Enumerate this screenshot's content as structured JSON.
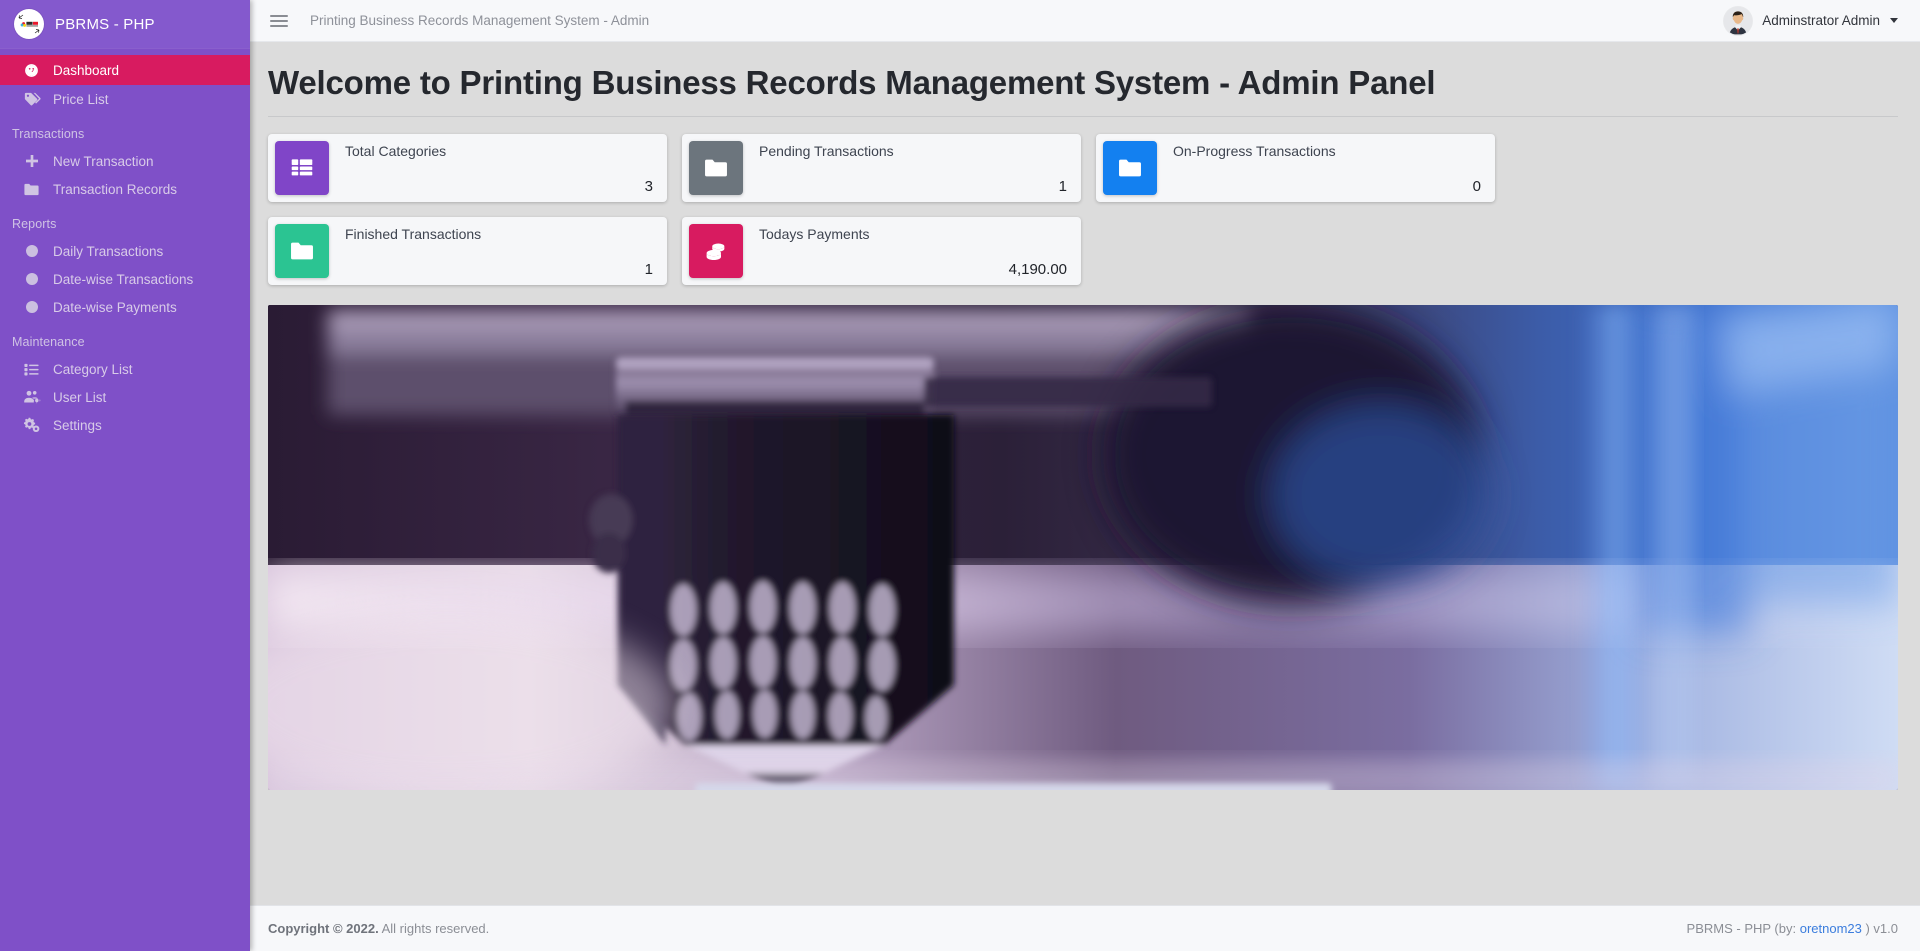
{
  "brand": {
    "title": "PBRMS - PHP",
    "logo_icon": "print-place-logo-icon"
  },
  "sidebar": {
    "items": [
      {
        "label": "Dashboard",
        "icon": "dashboard-gauge-icon",
        "active": true
      },
      {
        "label": "Price List",
        "icon": "price-tag-icon",
        "active": false
      }
    ],
    "groups": [
      {
        "header": "Transactions",
        "items": [
          {
            "label": "New Transaction",
            "icon": "plus-icon"
          },
          {
            "label": "Transaction Records",
            "icon": "folder-icon"
          }
        ]
      },
      {
        "header": "Reports",
        "items": [
          {
            "label": "Daily Transactions",
            "icon": "circle-icon"
          },
          {
            "label": "Date-wise Transactions",
            "icon": "circle-icon"
          },
          {
            "label": "Date-wise Payments",
            "icon": "circle-icon"
          }
        ]
      },
      {
        "header": "Maintenance",
        "items": [
          {
            "label": "Category List",
            "icon": "list-icon"
          },
          {
            "label": "User List",
            "icon": "users-gear-icon"
          },
          {
            "label": "Settings",
            "icon": "gears-icon"
          }
        ]
      }
    ]
  },
  "topbar": {
    "menu_icon": "hamburger-icon",
    "title": "Printing Business Records Management System - Admin",
    "user_name": "Adminstrator Admin",
    "avatar_icon": "user-avatar-icon",
    "caret_icon": "chevron-down-icon"
  },
  "page": {
    "title": "Welcome to Printing Business Records Management System - Admin Panel"
  },
  "cards": [
    {
      "label": "Total Categories",
      "value": "3",
      "icon": "table-grid-icon",
      "color": "#8045c8"
    },
    {
      "label": "Pending Transactions",
      "value": "1",
      "icon": "folder-icon",
      "color": "#6c757d"
    },
    {
      "label": "On-Progress Transactions",
      "value": "0",
      "icon": "folder-icon",
      "color": "#1380f0"
    },
    {
      "label": "Finished Transactions",
      "value": "1",
      "icon": "folder-icon",
      "color": "#2bc492"
    },
    {
      "label": "Todays Payments",
      "value": "4,190.00",
      "icon": "coins-stack-icon",
      "color": "#d81b60"
    }
  ],
  "hero": {
    "alt": "3d-printer-nozzle-photo"
  },
  "footer": {
    "copyright_strong": "Copyright © 2022.",
    "copyright_rest": " All rights reserved.",
    "credit_prefix": "PBRMS - PHP (by: ",
    "credit_link": "oretnom23",
    "credit_suffix": " ) v1.0"
  },
  "colors": {
    "sidebar": "#7f50c8",
    "sidebar_header": "#8459cd",
    "active": "#d81b60",
    "page_bg": "#dcdcdc",
    "panel_bg": "#f7f8fa",
    "link": "#3b7ddd"
  }
}
